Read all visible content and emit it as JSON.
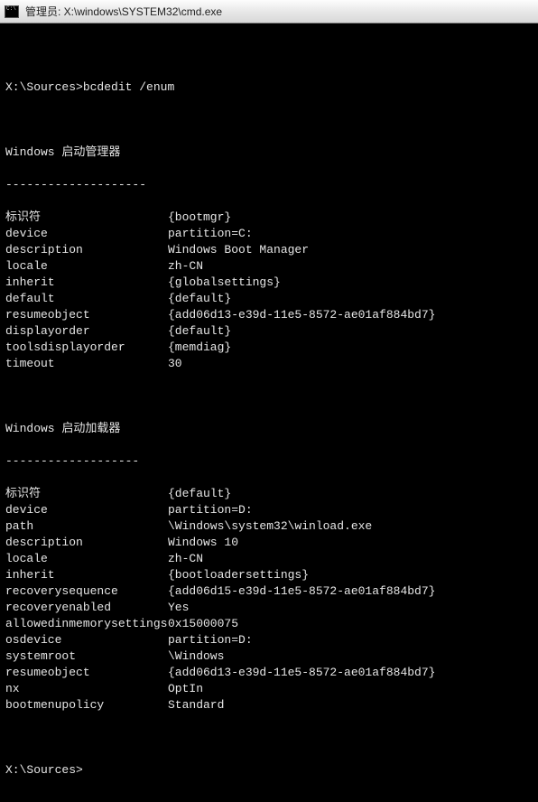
{
  "titlebar": {
    "text": "管理员: X:\\windows\\SYSTEM32\\cmd.exe"
  },
  "prompt": {
    "path": "X:\\Sources>",
    "command": "bcdedit /enum"
  },
  "sections": {
    "bootmgr": {
      "header": "Windows 启动管理器",
      "dashes": "--------------------",
      "rows": [
        {
          "k": "标识符",
          "v": "{bootmgr}"
        },
        {
          "k": "device",
          "v": "partition=C:"
        },
        {
          "k": "description",
          "v": "Windows Boot Manager"
        },
        {
          "k": "locale",
          "v": "zh-CN"
        },
        {
          "k": "inherit",
          "v": "{globalsettings}"
        },
        {
          "k": "default",
          "v": "{default}"
        },
        {
          "k": "resumeobject",
          "v": "{add06d13-e39d-11e5-8572-ae01af884bd7}"
        },
        {
          "k": "displayorder",
          "v": "{default}"
        },
        {
          "k": "toolsdisplayorder",
          "v": "{memdiag}"
        },
        {
          "k": "timeout",
          "v": "30"
        }
      ]
    },
    "loader": {
      "header": "Windows 启动加载器",
      "dashes": "-------------------",
      "rows": [
        {
          "k": "标识符",
          "v": "{default}"
        },
        {
          "k": "device",
          "v": "partition=D:"
        },
        {
          "k": "path",
          "v": "\\Windows\\system32\\winload.exe"
        },
        {
          "k": "description",
          "v": "Windows 10"
        },
        {
          "k": "locale",
          "v": "zh-CN"
        },
        {
          "k": "inherit",
          "v": "{bootloadersettings}"
        },
        {
          "k": "recoverysequence",
          "v": "{add06d15-e39d-11e5-8572-ae01af884bd7}"
        },
        {
          "k": "recoveryenabled",
          "v": "Yes"
        },
        {
          "k": "allowedinmemorysettings",
          "v": "0x15000075"
        },
        {
          "k": "osdevice",
          "v": "partition=D:"
        },
        {
          "k": "systemroot",
          "v": "\\Windows"
        },
        {
          "k": "resumeobject",
          "v": "{add06d13-e39d-11e5-8572-ae01af884bd7}"
        },
        {
          "k": "nx",
          "v": "OptIn"
        },
        {
          "k": "bootmenupolicy",
          "v": "Standard"
        }
      ]
    }
  },
  "endprompt": "X:\\Sources>"
}
